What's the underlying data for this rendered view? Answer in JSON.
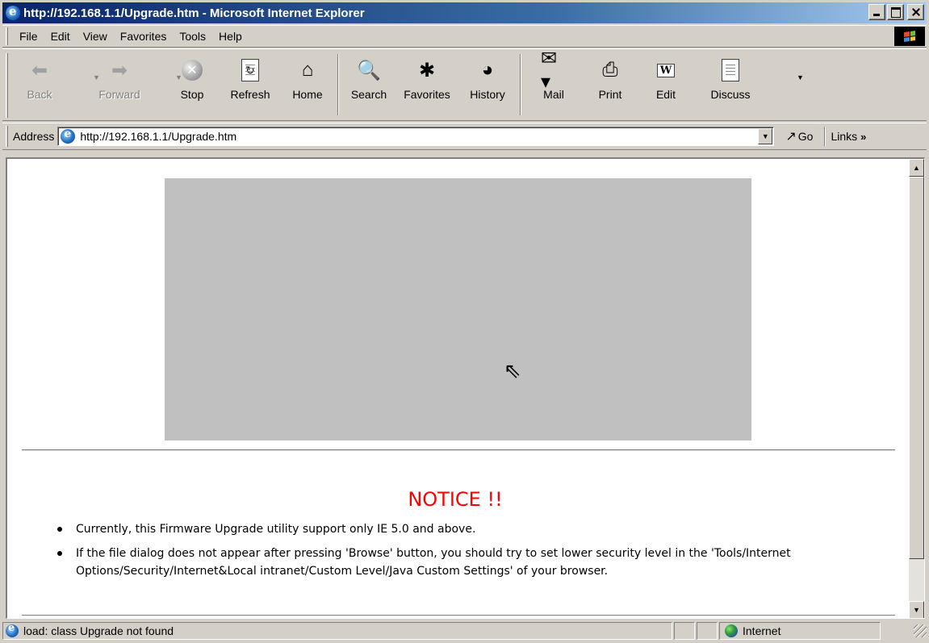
{
  "window": {
    "title": "http://192.168.1.1/Upgrade.htm - Microsoft Internet Explorer"
  },
  "menu": {
    "items": [
      {
        "label": "File"
      },
      {
        "label": "Edit"
      },
      {
        "label": "View"
      },
      {
        "label": "Favorites"
      },
      {
        "label": "Tools"
      },
      {
        "label": "Help"
      }
    ]
  },
  "toolbar": {
    "back": "Back",
    "forward": "Forward",
    "stop": "Stop",
    "refresh": "Refresh",
    "home": "Home",
    "search": "Search",
    "favorites": "Favorites",
    "history": "History",
    "mail": "Mail",
    "print": "Print",
    "edit": "Edit",
    "discuss": "Discuss"
  },
  "address": {
    "label": "Address",
    "url": "http://192.168.1.1/Upgrade.htm",
    "go": "Go",
    "links": "Links"
  },
  "page": {
    "notice_title": "NOTICE !!",
    "notes": [
      "Currently, this Firmware Upgrade utility support only IE 5.0 and above.",
      "If the file dialog does not appear after pressing 'Browse' button, you should try to set lower security level in the 'Tools/Internet Options/Security/Internet&Local intranet/Custom Level/Java Custom Settings' of your browser."
    ]
  },
  "status": {
    "message": "load: class Upgrade not found",
    "zone": "Internet"
  },
  "colors": {
    "titlebar_start": "#0a246a",
    "titlebar_end": "#a6caf0",
    "chrome": "#d4d0c8",
    "applet_bg": "#c0c0c0",
    "notice": "#ff0000"
  },
  "icons": {
    "ie": "ie-logo-icon",
    "back": "back-arrow-icon",
    "forward": "forward-arrow-icon",
    "stop": "stop-icon",
    "refresh": "refresh-icon",
    "home": "home-icon",
    "search": "search-icon",
    "favorites": "favorites-icon",
    "history": "history-icon",
    "mail": "mail-icon",
    "print": "print-icon",
    "edit": "edit-word-icon",
    "discuss": "discuss-icon",
    "globe": "internet-globe-icon",
    "windows": "windows-logo-icon"
  }
}
